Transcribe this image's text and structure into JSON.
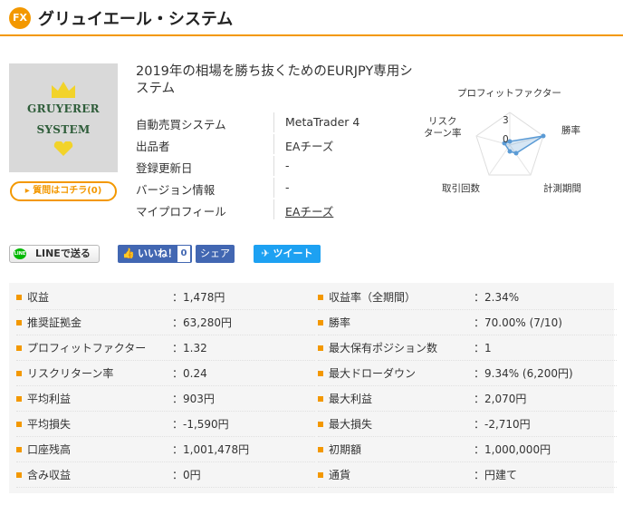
{
  "header": {
    "badge": "FX",
    "title": "グリュイエール・システム"
  },
  "logo": {
    "line1": "GRUYERER",
    "line2": "SYSTEM"
  },
  "question_button": "▸ 質問はコチラ(0)",
  "headline": "2019年の相場を勝ち抜くためのEURJPY専用システム",
  "info": [
    {
      "label": "自動売買システム",
      "value": "MetaTrader 4"
    },
    {
      "label": "出品者",
      "value": "EAチーズ"
    },
    {
      "label": "登録更新日",
      "value": "-"
    },
    {
      "label": "バージョン情報",
      "value": "-"
    },
    {
      "label": "マイプロフィール",
      "value": "EAチーズ"
    }
  ],
  "radar": {
    "labels": [
      "プロフィットファクター",
      "勝率",
      "計測期間",
      "取引回数",
      "リスク\nターン率"
    ],
    "scale_labels": [
      "3",
      "0"
    ],
    "color": "#5b9bd5"
  },
  "share": {
    "line": "LINEで送る",
    "line_icon": "LINE",
    "like": "いいね！",
    "like_count": "0",
    "share": "シェア",
    "tweet": "ツイート"
  },
  "stats_left": [
    {
      "label": "収益",
      "value": "：1,478円"
    },
    {
      "label": "推奨証拠金",
      "value": "：63,280円"
    },
    {
      "label": "プロフィットファクター",
      "value": "：1.32"
    },
    {
      "label": "リスクリターン率",
      "value": "：0.24"
    },
    {
      "label": "平均利益",
      "value": "：903円"
    },
    {
      "label": "平均損失",
      "value": "：-1,590円"
    },
    {
      "label": "口座残高",
      "value": "：1,001,478円"
    },
    {
      "label": "含み収益",
      "value": "：0円"
    }
  ],
  "stats_right": [
    {
      "label": "収益率（全期間）",
      "value": "：2.34%"
    },
    {
      "label": "勝率",
      "value": "：70.00% (7/10)"
    },
    {
      "label": "最大保有ポジション数",
      "value": "：1"
    },
    {
      "label": "最大ドローダウン",
      "value": "：9.34% (6,200円)"
    },
    {
      "label": "最大利益",
      "value": "：2,070円"
    },
    {
      "label": "最大損失",
      "value": "：-2,710円"
    },
    {
      "label": "初期額",
      "value": "：1,000,000円"
    },
    {
      "label": "通貨",
      "value": "：円建て"
    }
  ]
}
